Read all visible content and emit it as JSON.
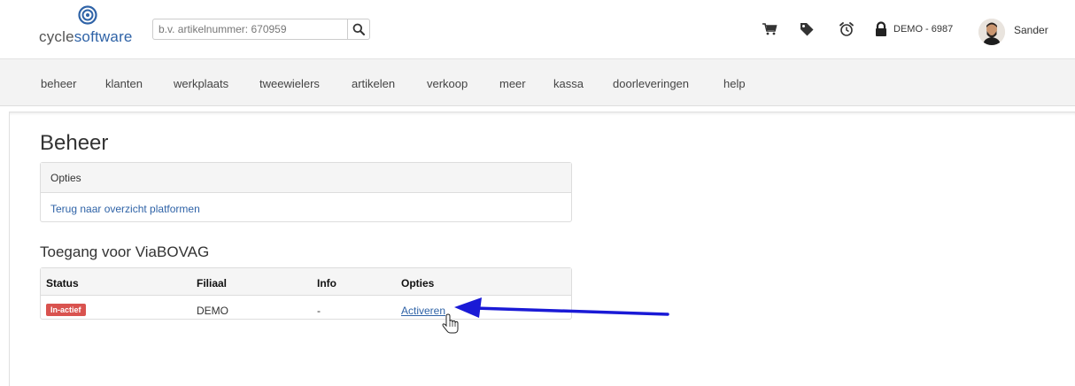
{
  "brand": {
    "prefix": "cycle",
    "suffix": "software"
  },
  "search": {
    "placeholder": "b.v. artikelnummer: 670959"
  },
  "toolbar": {
    "icons": [
      "cart-icon",
      "tag-icon",
      "alarm-clock-icon",
      "lock-icon"
    ],
    "location_label": "DEMO - 6987",
    "user_name": "Sander"
  },
  "nav": {
    "items": [
      "beheer",
      "klanten",
      "werkplaats",
      "tweewielers",
      "artikelen",
      "verkoop",
      "meer",
      "kassa",
      "doorleveringen",
      "help"
    ]
  },
  "page": {
    "title": "Beheer"
  },
  "options_panel": {
    "heading": "Opties",
    "link": "Terug naar overzicht platformen"
  },
  "access": {
    "title": "Toegang voor ViaBOVAG",
    "columns": [
      "Status",
      "Filiaal",
      "Info",
      "Opties"
    ],
    "row": {
      "status": "In-actief",
      "branch": "DEMO",
      "info": "-",
      "action": "Activeren"
    }
  },
  "colors": {
    "accent": "#2f63a7",
    "status_inactive": "#d9534f",
    "annotation_arrow": "#1a1ad6"
  }
}
